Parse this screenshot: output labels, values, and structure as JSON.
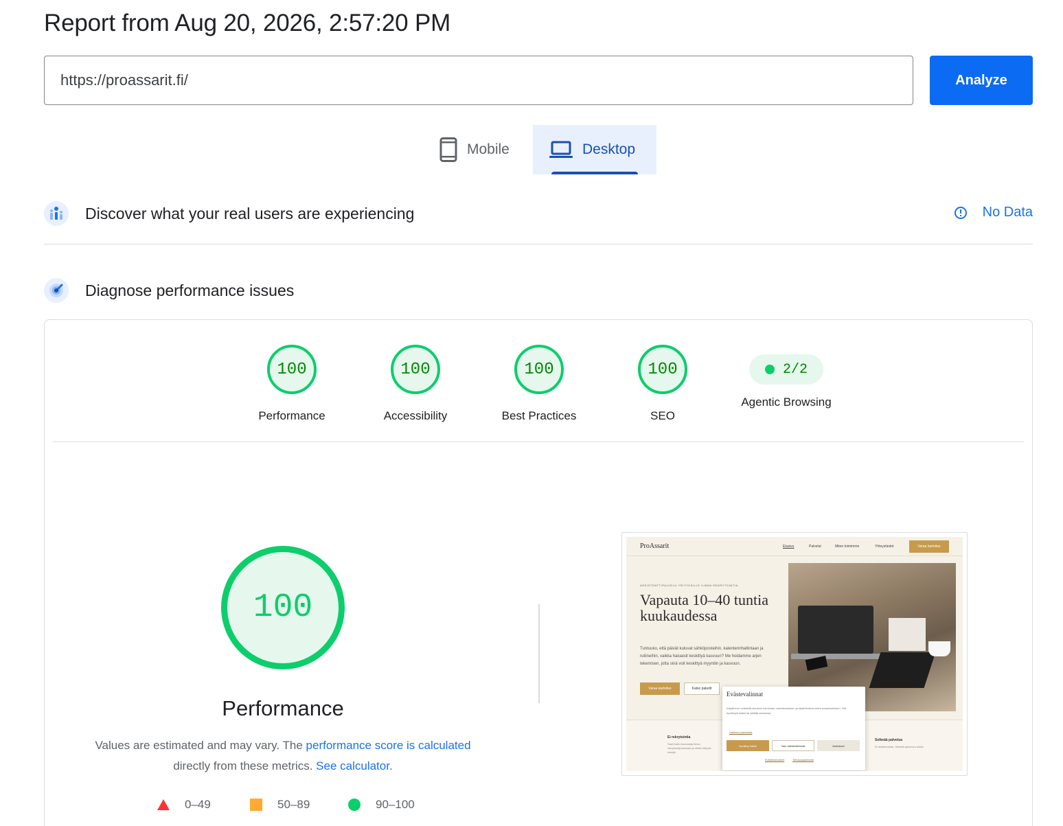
{
  "header": {
    "title": "Report from Aug 20, 2026, 2:57:20 PM"
  },
  "url_input": {
    "value": "https://proassarit.fi/"
  },
  "analyze_button": {
    "label": "Analyze"
  },
  "device_tabs": {
    "mobile": "Mobile",
    "desktop": "Desktop",
    "selected": "Desktop"
  },
  "field_data": {
    "title": "Discover what your real users are experiencing",
    "status": "No Data"
  },
  "diagnose": {
    "title": "Diagnose performance issues"
  },
  "gauges": [
    {
      "score": "100",
      "label": "Performance"
    },
    {
      "score": "100",
      "label": "Accessibility"
    },
    {
      "score": "100",
      "label": "Best Practices"
    },
    {
      "score": "100",
      "label": "SEO"
    }
  ],
  "agentic": {
    "score": "2/2",
    "label": "Agentic Browsing"
  },
  "performance": {
    "score": "100",
    "title": "Performance",
    "note_prefix": "Values are estimated and may vary. The",
    "note_link": "performance score is calculated",
    "note_mid": "directly from these metrics.",
    "note_link2": "See calculator."
  },
  "legend": [
    {
      "range": "0–49",
      "shape": "triangle",
      "color": "#ff3333"
    },
    {
      "range": "50–89",
      "shape": "square",
      "color": "#ffaa33"
    },
    {
      "range": "90–100",
      "shape": "circle",
      "color": "#0cce6b"
    }
  ],
  "colors": {
    "accent": "#1a73e8",
    "pass": "#0cce6b",
    "pass_text": "#008800",
    "pass_bg": "#e6f8ee"
  },
  "screenshot": {
    "logo": "ProAssarit",
    "nav": [
      "Etusivu",
      "Palvelut",
      "Miten toimimme",
      "Yhteystiedot"
    ],
    "nav_cta": "Varaa kartoitus",
    "kicker": "ASSISTENTTIPALVELU YRITYKSILLE ILMAN REKRYTOINTIA",
    "headline": "Vapauta 10–40 tuntia kuukaudessa",
    "body": "Tuntuuko, että päivät kuluvat sähköposteihin, kalenterinhallintaan ja rutiineihin, vaikka haluaisit keskittyä kasvuun? Me hoidamme arjen tekemisen, jotta sinä voit keskittyä myyntiin ja kasvuun.",
    "cta_primary": "Varaa kartoitus",
    "cta_secondary": "Katso paketit",
    "strip_left_title": "Ei rekrytointia",
    "strip_left_text": "Saat lisää resursseja ilman rekrytointiprosessia ja siihen liittyviä riskejä.",
    "strip_right_title": "Selkeää palvelua",
    "strip_right_text": "Ei ahdistumista. Selkeät ajoneuvo sinkä.",
    "cookie_title": "Evästevalinnat",
    "cookie_text": "Käytämme evästeitä sivuston toiminnan varmistamiseen ja käyttökokemuksen parantamiseen. Voit hyväksyä kaikki tai säätää asetuksia.",
    "cookie_link": "Hallinnoi palveluita",
    "cookie_accept": "Hyväksy kaikki",
    "cookie_necessary": "Vain välttämättömät",
    "cookie_settings": "Asetukset",
    "cookie_foot1": "Evästeselosteet",
    "cookie_foot2": "Tietosuojaseloste"
  }
}
